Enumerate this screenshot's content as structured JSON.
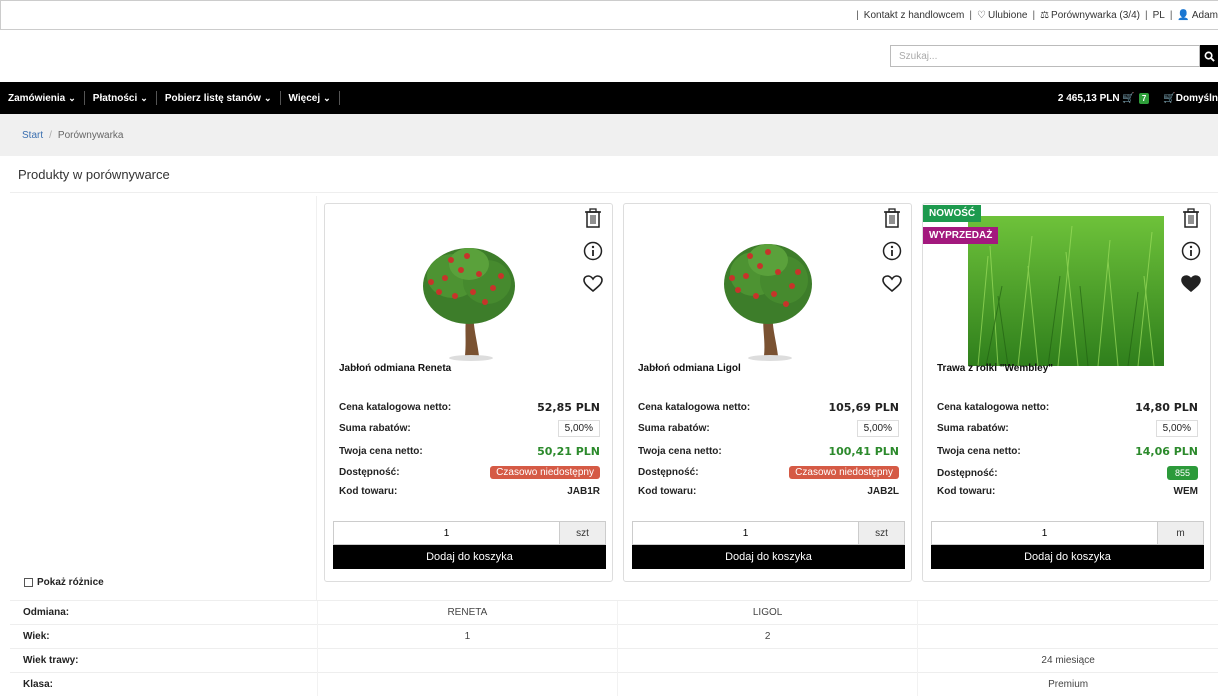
{
  "topbar": {
    "contact": "Kontakt z handlowcem",
    "favorites": "Ulubione",
    "compare": "Porównywarka (3/4)",
    "lang": "PL",
    "user": "Adam"
  },
  "search": {
    "placeholder": "Szukaj..."
  },
  "nav": {
    "items": [
      "Zamówienia",
      "Płatności",
      "Pobierz listę stanów",
      "Więcej"
    ],
    "cart_total": "2 465,13 PLN",
    "cart_count": "7",
    "default_label": "Domyśln"
  },
  "breadcrumb": {
    "start": "Start",
    "current": "Porównywarka"
  },
  "page_title": "Produkty w porównywarce",
  "labels": {
    "catalog_price": "Cena katalogowa netto:",
    "discount": "Suma rabatów:",
    "your_price": "Twoja cena netto:",
    "availability": "Dostępność:",
    "code": "Kod towaru:",
    "add_to_cart": "Dodaj do koszyka",
    "show_diff": "Pokaż różnice"
  },
  "products": [
    {
      "name": "Jabłoń odmiana Reneta",
      "catalog_price": "52,85 PLN",
      "discount": "5,00%",
      "your_price": "50,21 PLN",
      "availability": "Czasowo niedostępny",
      "code": "JAB1R",
      "qty": "1",
      "unit": "szt",
      "favorite": false
    },
    {
      "name": "Jabłoń odmiana Ligol",
      "catalog_price": "105,69 PLN",
      "discount": "5,00%",
      "your_price": "100,41 PLN",
      "availability": "Czasowo niedostępny",
      "code": "JAB2L",
      "qty": "1",
      "unit": "szt",
      "favorite": false
    },
    {
      "name": "Trawa z rolki \"Wembley\"",
      "catalog_price": "14,80 PLN",
      "discount": "5,00%",
      "your_price": "14,06 PLN",
      "availability": "855",
      "code": "WEM",
      "qty": "1",
      "unit": "m",
      "favorite": true,
      "tags": [
        "NOWOŚĆ",
        "WYPRZEDAŻ"
      ]
    }
  ],
  "attributes": [
    {
      "label": "Odmiana:",
      "values": [
        "RENETA",
        "LIGOL",
        ""
      ]
    },
    {
      "label": "Wiek:",
      "values": [
        "1",
        "2",
        ""
      ]
    },
    {
      "label": "Wiek trawy:",
      "values": [
        "",
        "",
        "24 miesiące"
      ]
    },
    {
      "label": "Klasa:",
      "values": [
        "",
        "",
        "Premium"
      ]
    }
  ],
  "colors": {
    "accent_green": "#2c8a2c",
    "badge_red": "#d55a45",
    "tag_new": "#1d9a4e",
    "tag_sale": "#a3197e"
  }
}
